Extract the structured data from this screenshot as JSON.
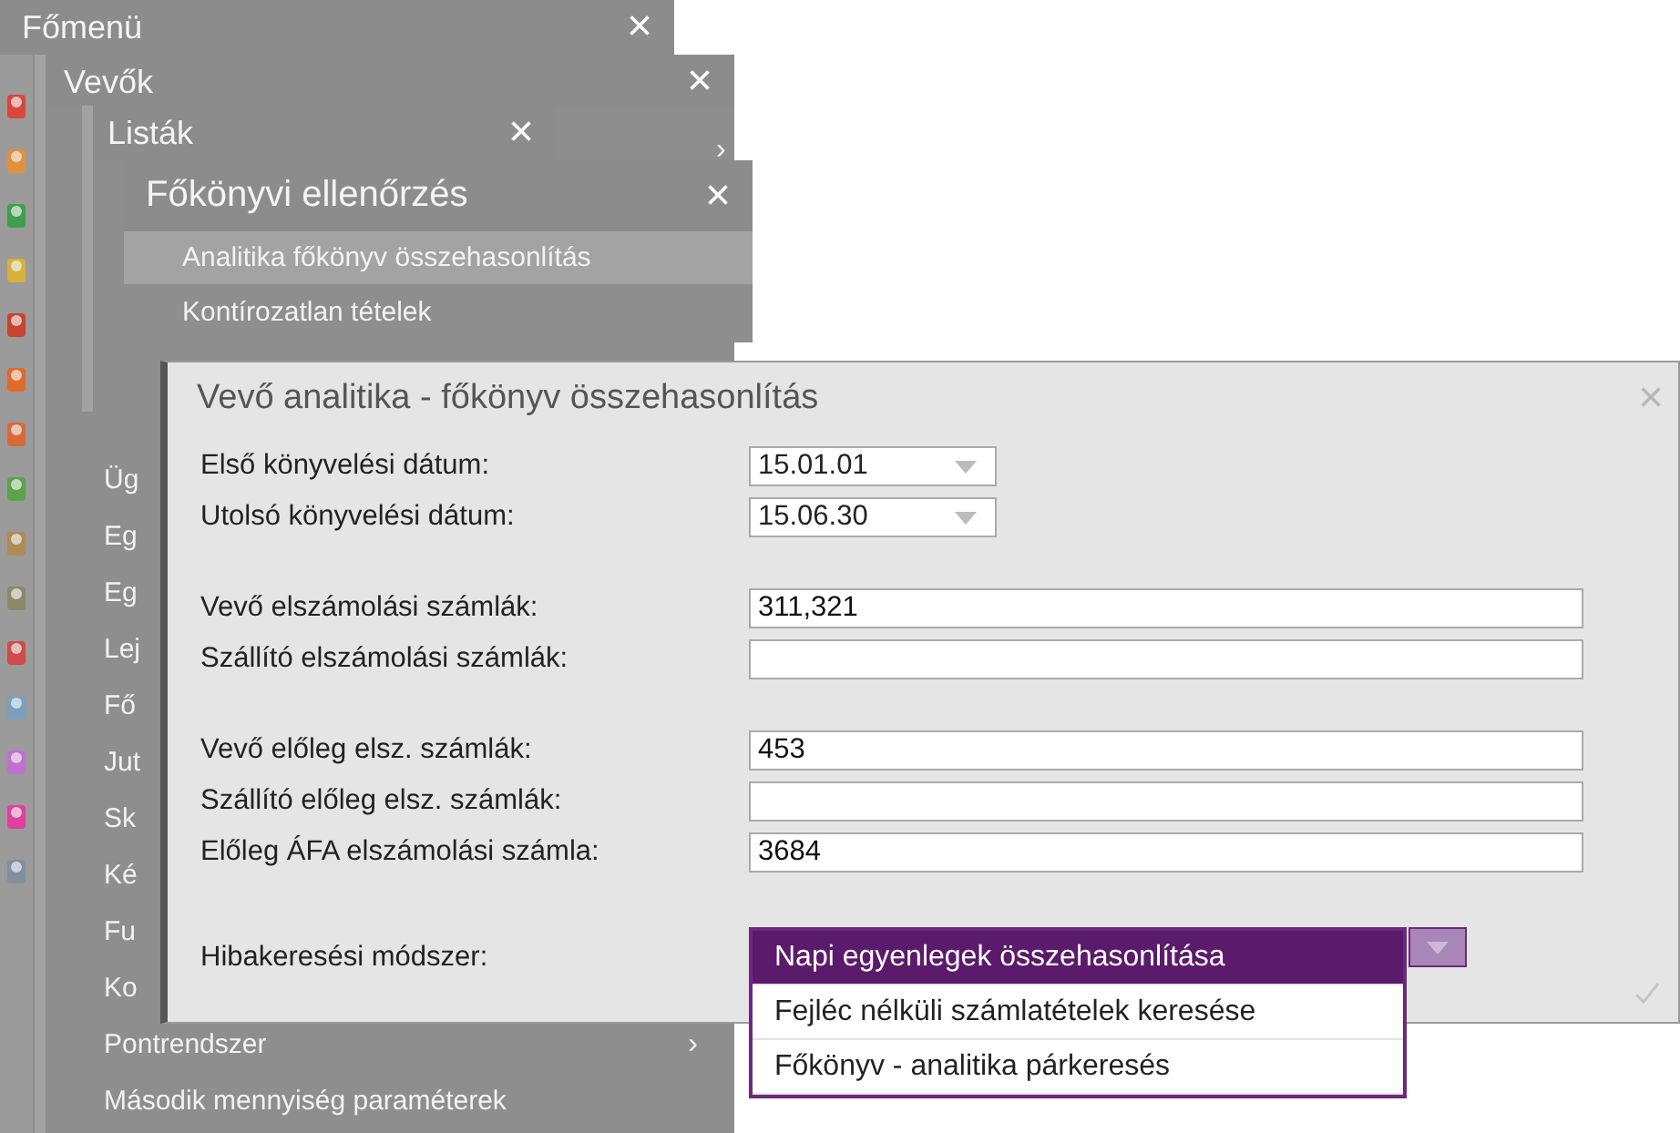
{
  "main_menu": {
    "title": "Főmenü",
    "close": "×",
    "module_icons": [
      {
        "color": "#d9463b"
      },
      {
        "color": "#e0913a"
      },
      {
        "color": "#3f9f4a"
      },
      {
        "color": "#d8b13a"
      },
      {
        "color": "#c9442f"
      },
      {
        "color": "#e06a2a"
      },
      {
        "color": "#d86a3a"
      },
      {
        "color": "#5aa34a"
      },
      {
        "color": "#b08a55"
      },
      {
        "color": "#8a8a6a"
      },
      {
        "color": "#d04a4a"
      },
      {
        "color": "#7aa0c0"
      },
      {
        "color": "#c070d0"
      },
      {
        "color": "#e040a0"
      },
      {
        "color": "#8090a0"
      }
    ]
  },
  "customers_window": {
    "title": "Vevők",
    "close": "×",
    "submenu_arrow": "›",
    "items": [
      {
        "label": "Üg"
      },
      {
        "label": "Eg"
      },
      {
        "label": "Eg"
      },
      {
        "label": "Lej"
      },
      {
        "label": "Fő"
      },
      {
        "label": "Jut"
      },
      {
        "label": "Sk"
      },
      {
        "label": "Ké"
      },
      {
        "label": "Fu"
      },
      {
        "label": "Ko"
      },
      {
        "label": "Pontrendszer",
        "submenu": true
      },
      {
        "label": "Második mennyiség paraméterek",
        "submenu": false
      }
    ]
  },
  "lists_window": {
    "title": "Listák",
    "close": "×"
  },
  "ledger_check_window": {
    "title": "Főkönyvi ellenőrzés",
    "close": "×",
    "items": [
      {
        "label": "Analitika főkönyv összehasonlítás",
        "selected": true
      },
      {
        "label": "Kontírozatlan tételek",
        "selected": false
      }
    ]
  },
  "dialog": {
    "title": "Vevő analitika - főkönyv összehasonlítás",
    "close": "×",
    "field_groups": [
      [
        {
          "kind": "date",
          "label": "Első könyvelési dátum:",
          "value": "15.01.01"
        },
        {
          "kind": "date",
          "label": "Utolsó könyvelési dátum:",
          "value": "15.06.30"
        }
      ],
      [
        {
          "kind": "text",
          "label": "Vevő elszámolási számlák:",
          "value": "311,321"
        },
        {
          "kind": "text",
          "label": "Szállító elszámolási számlák:"
        }
      ],
      [
        {
          "kind": "text",
          "label": "Vevő előleg elsz. számlák:",
          "value": "453"
        },
        {
          "kind": "text",
          "label": "Szállító előleg elsz. számlák:"
        },
        {
          "kind": "text",
          "label": "Előleg ÁFA elszámolási számla:",
          "value": "3684"
        }
      ]
    ],
    "method": {
      "label": "Hibakeresési módszer:",
      "expanded": true,
      "options": [
        {
          "label": "Napi egyenlegek összehasonlítása",
          "selected": true
        },
        {
          "label": "Fejléc nélküli számlatételek keresése",
          "selected": false
        },
        {
          "label": "Főkönyv - analitika párkeresés",
          "selected": false
        }
      ]
    }
  }
}
